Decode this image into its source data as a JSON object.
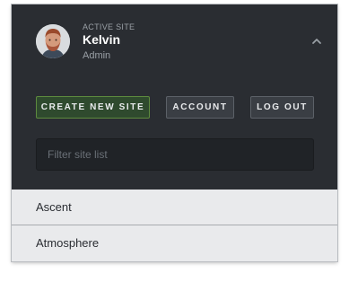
{
  "site_switcher": {
    "active_label": "ACTIVE SITE",
    "site_name": "Kelvin",
    "role": "Admin",
    "collapse_icon": "chevron-up-icon"
  },
  "actions": {
    "create_new_site": "CREATE NEW SITE",
    "account": "ACCOUNT",
    "log_out": "LOG OUT"
  },
  "filter": {
    "placeholder": "Filter site list",
    "value": ""
  },
  "sites": [
    {
      "name": "Ascent"
    },
    {
      "name": "Atmosphere"
    }
  ],
  "colors": {
    "panel_background": "#2a2d32",
    "create_button_border": "#5d8a3e",
    "list_background": "#e9eaec"
  }
}
